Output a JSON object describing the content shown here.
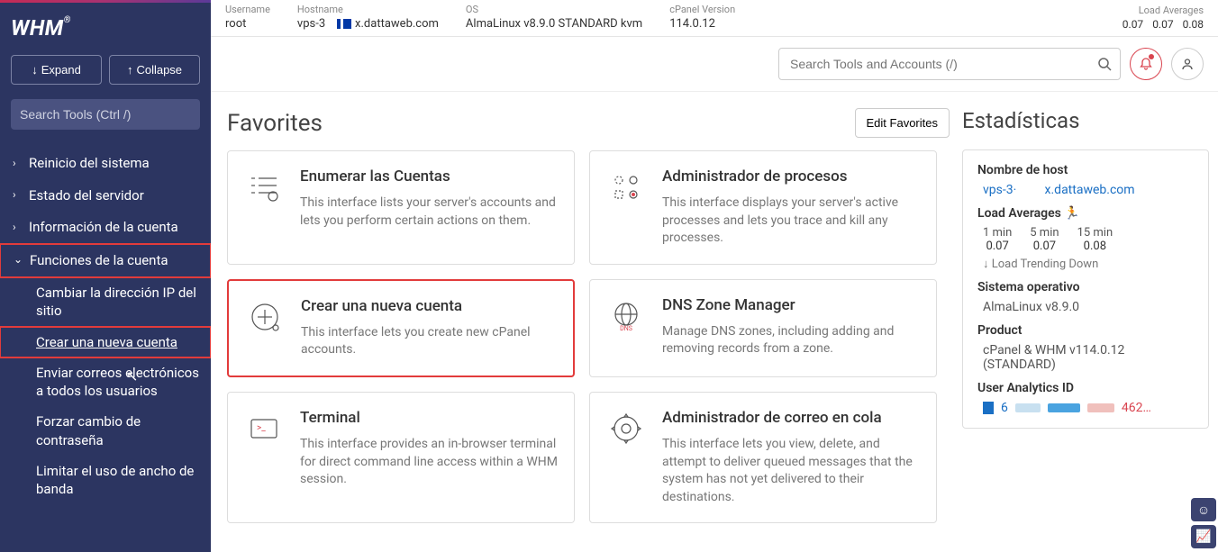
{
  "header": {
    "username_lbl": "Username",
    "username": "root",
    "hostname_lbl": "Hostname",
    "hostname": "vps-3",
    "domain": "x.dattaweb.com",
    "os_lbl": "OS",
    "os": "AlmaLinux v8.9.0 STANDARD kvm",
    "cp_lbl": "cPanel Version",
    "cp": "114.0.12",
    "la_lbl": "Load Averages",
    "la1": "0.07",
    "la5": "0.07",
    "la15": "0.08"
  },
  "sidebar": {
    "logo": "WHM",
    "expand": "Expand",
    "collapse": "Collapse",
    "search_ph": "Search Tools (Ctrl /)",
    "items": {
      "reinicio": "Reinicio del sistema",
      "estado": "Estado del servidor",
      "info": "Información de la cuenta",
      "funciones": "Funciones de la cuenta",
      "cambiar": "Cambiar la dirección IP del sitio",
      "crear": "Crear una nueva cuenta",
      "enviar": "Enviar correos electrónicos a todos los usuarios",
      "forzar": "Forzar cambio de contraseña",
      "limitar": "Limitar el uso de ancho de banda"
    }
  },
  "search_ph": "Search Tools and Accounts (/)",
  "fav": {
    "title": "Favorites",
    "edit": "Edit Favorites"
  },
  "cards": {
    "c1": {
      "t": "Enumerar las Cuentas",
      "d": "This interface lists your server's accounts and lets you perform certain actions on them."
    },
    "c2": {
      "t": "Administrador de procesos",
      "d": "This interface displays your server's active processes and lets you trace and kill any processes."
    },
    "c3": {
      "t": "Crear una nueva cuenta",
      "d": "This interface lets you create new cPanel accounts."
    },
    "c4": {
      "t": "DNS Zone Manager",
      "d": "Manage DNS zones, including adding and removing records from a zone."
    },
    "c5": {
      "t": "Terminal",
      "d": "This interface provides an in-browser terminal for direct command line access within a WHM session."
    },
    "c6": {
      "t": "Administrador de correo en cola",
      "d": "This interface lets you view, delete, and attempt to deliver queued messages that the system has not yet delivered to their destinations."
    }
  },
  "stats": {
    "title": "Estadísticas",
    "host_lbl": "Nombre de host",
    "host_a": "vps-3·",
    "host_b": "x.dattaweb.com",
    "la_lbl": "Load Averages",
    "m1": "1 min",
    "m5": "5 min",
    "m15": "15 min",
    "v1": "0.07",
    "v5": "0.07",
    "v15": "0.08",
    "trend": "Load Trending Down",
    "os_lbl": "Sistema operativo",
    "os": "AlmaLinux v8.9.0",
    "prod_lbl": "Product",
    "prod": "cPanel & WHM v114.0.12 (STANDARD)",
    "ua_lbl": "User Analytics ID",
    "ua_n1": "6",
    "ua_n2": "462…"
  }
}
